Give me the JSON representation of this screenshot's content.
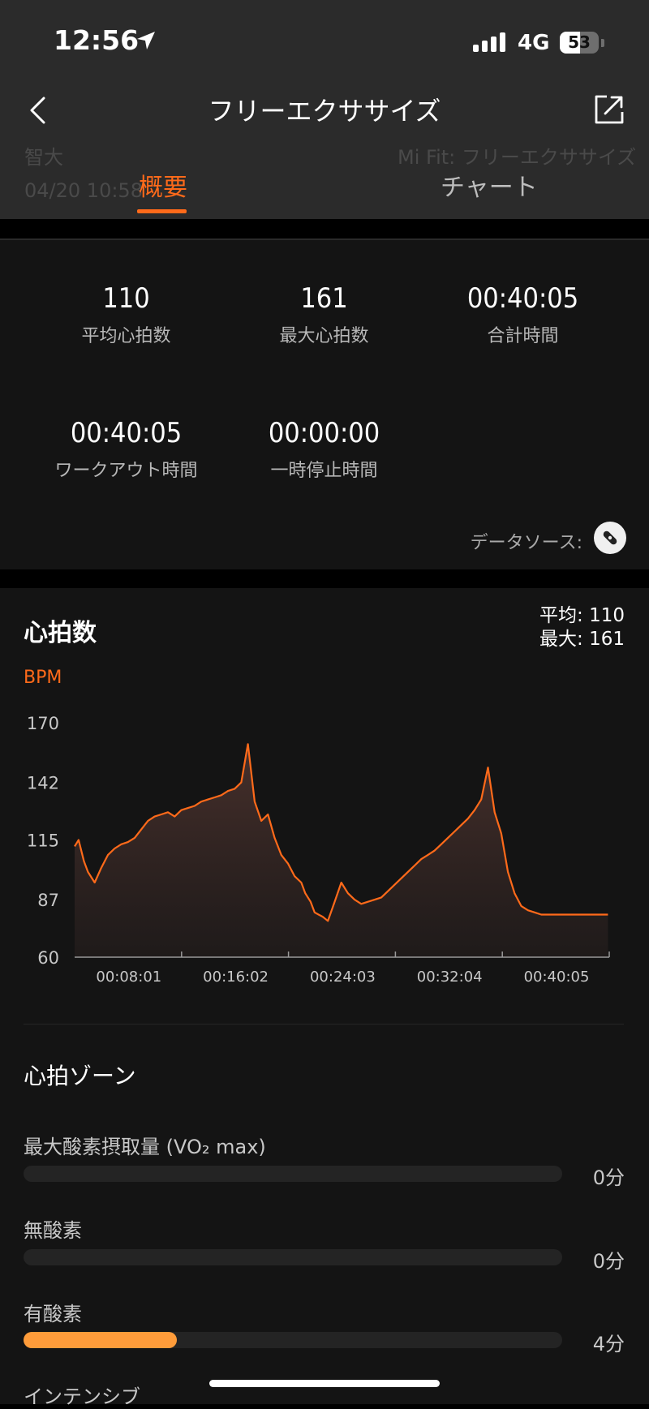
{
  "status_bar": {
    "time": "12:56",
    "network": "4G",
    "battery": "53",
    "battery_level": 0.53
  },
  "nav": {
    "title": "フリーエクササイズ"
  },
  "behind_text": {
    "user": "智大",
    "date": "04/20 10:58",
    "source": "Mi Fit: フリーエクササイズ"
  },
  "tabs": [
    {
      "label": "概要",
      "active": true
    },
    {
      "label": "チャート",
      "active": false
    }
  ],
  "stats": [
    {
      "value": "110",
      "label": "平均心拍数"
    },
    {
      "value": "161",
      "label": "最大心拍数"
    },
    {
      "value": "00:40:05",
      "label": "合計時間"
    },
    {
      "value": "00:40:05",
      "label": "ワークアウト時間"
    },
    {
      "value": "00:00:00",
      "label": "一時停止時間"
    }
  ],
  "data_source_label": "データソース:",
  "heart_rate": {
    "title": "心拍数",
    "avg_text": "平均: 110",
    "max_text": "最大: 161",
    "unit": "BPM"
  },
  "chart_data": {
    "type": "area",
    "ylabel": "BPM",
    "yticks": [
      "170",
      "142",
      "115",
      "87",
      "60"
    ],
    "ylim": [
      60,
      170
    ],
    "xticks": [
      "00:08:01",
      "00:16:02",
      "00:24:03",
      "00:32:04",
      "00:40:05"
    ],
    "x_unit": "minutes",
    "xlim": [
      0,
      40.1
    ],
    "series": [
      {
        "x": [
          0.0,
          0.3,
          0.7,
          1.0,
          1.5,
          2.0,
          2.5,
          3.0,
          3.5,
          4.0,
          4.5,
          5.0,
          5.5,
          6.0,
          6.5,
          7.0,
          7.5,
          8.0,
          8.5,
          9.0,
          9.5,
          10.0,
          10.5,
          11.0,
          11.5,
          12.0,
          12.5,
          13.0,
          13.5,
          14.0,
          14.5,
          15.0,
          15.5,
          16.0,
          16.5,
          17.0,
          17.3,
          17.7,
          18.0,
          18.3,
          18.6,
          19.0,
          19.5,
          20.0,
          20.5,
          21.0,
          21.5,
          22.0,
          22.5,
          23.0,
          23.5,
          24.0,
          24.5,
          25.0,
          25.5,
          26.0,
          26.5,
          27.0,
          27.5,
          28.0,
          28.5,
          29.0,
          29.5,
          30.0,
          30.5,
          31.0,
          31.5,
          32.0,
          32.5,
          33.0,
          33.5,
          34.0,
          34.5,
          35.0,
          35.5,
          36.0,
          36.5,
          37.0,
          37.5,
          38.0,
          38.5,
          39.0,
          39.5,
          40.0
        ],
        "values": [
          112,
          115,
          105,
          100,
          95,
          102,
          108,
          111,
          113,
          114,
          116,
          120,
          124,
          126,
          127,
          128,
          126,
          129,
          130,
          131,
          133,
          134,
          135,
          136,
          138,
          139,
          142,
          160,
          133,
          124,
          127,
          116,
          108,
          104,
          98,
          95,
          90,
          86,
          81,
          80,
          79,
          77,
          86,
          95,
          90,
          87,
          85,
          86,
          87,
          88,
          91,
          94,
          97,
          100,
          103,
          106,
          108,
          110,
          113,
          116,
          119,
          122,
          125,
          129,
          134,
          149,
          128,
          118,
          100,
          90,
          84,
          82,
          81,
          80,
          80,
          80,
          80,
          80,
          80,
          80,
          80,
          80,
          80,
          80
        ]
      }
    ],
    "grid": false,
    "legend": "none"
  },
  "zones": {
    "title": "心拍ゾーン",
    "items": [
      {
        "label": "最大酸素摂取量 (VO₂ max)",
        "time": "0分",
        "fraction": 0
      },
      {
        "label": "無酸素",
        "time": "0分",
        "fraction": 0
      },
      {
        "label": "有酸素",
        "time": "4分",
        "fraction": 0.285
      },
      {
        "label": "インテンシブ",
        "time": "",
        "fraction": 0
      }
    ]
  },
  "colors": {
    "accent": "#ff6a1a",
    "zone_fill": "#ff9c3a",
    "header_bg": "#2b2b2b",
    "card_bg": "#141414"
  }
}
